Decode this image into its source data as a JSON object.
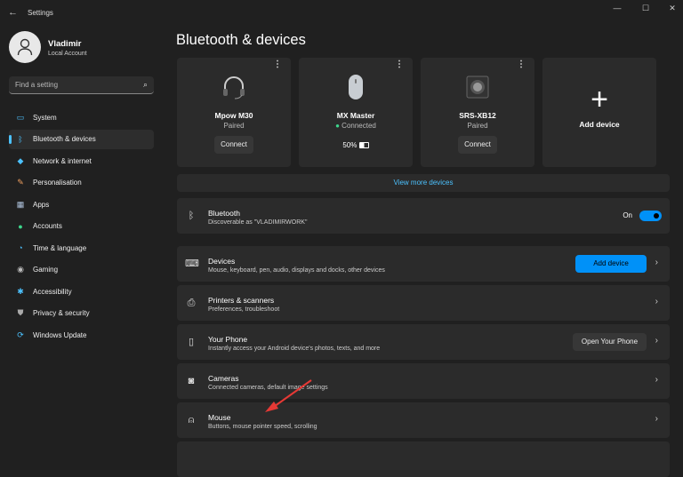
{
  "window": {
    "title": "Settings",
    "back": "←",
    "minimize": "—",
    "maximize": "☐",
    "close": "✕"
  },
  "user": {
    "name": "Vladimir",
    "account": "Local Account"
  },
  "search": {
    "placeholder": "Find a setting"
  },
  "sidebar": {
    "items": [
      {
        "label": "System",
        "icon": "system-icon",
        "color": "#4cc2ff"
      },
      {
        "label": "Bluetooth & devices",
        "icon": "bluetooth-icon",
        "color": "#4cc2ff",
        "selected": true
      },
      {
        "label": "Network & internet",
        "icon": "wifi-icon",
        "color": "#4cc2ff"
      },
      {
        "label": "Personalisation",
        "icon": "brush-icon",
        "color": "#f0a060"
      },
      {
        "label": "Apps",
        "icon": "apps-icon",
        "color": "#b0c4de"
      },
      {
        "label": "Accounts",
        "icon": "accounts-icon",
        "color": "#3dd68c"
      },
      {
        "label": "Time & language",
        "icon": "globe-icon",
        "color": "#4cc2ff"
      },
      {
        "label": "Gaming",
        "icon": "gamepad-icon",
        "color": "#bbb"
      },
      {
        "label": "Accessibility",
        "icon": "accessibility-icon",
        "color": "#4cc2ff"
      },
      {
        "label": "Privacy & security",
        "icon": "shield-icon",
        "color": "#aaa"
      },
      {
        "label": "Windows Update",
        "icon": "update-icon",
        "color": "#4cc2ff"
      }
    ]
  },
  "main": {
    "title": "Bluetooth & devices",
    "devices": [
      {
        "name": "Mpow M30",
        "status": "Paired",
        "button": "Connect"
      },
      {
        "name": "MX Master",
        "status": "Connected",
        "battery": "50%"
      },
      {
        "name": "SRS-XB12",
        "status": "Paired",
        "button": "Connect"
      }
    ],
    "add_device_card": "Add device",
    "view_more": "View more devices",
    "bluetooth": {
      "title": "Bluetooth",
      "subtitle": "Discoverable as \"VLADIMIRWORK\"",
      "state": "On"
    },
    "rows": [
      {
        "title": "Devices",
        "subtitle": "Mouse, keyboard, pen, audio, displays and docks, other devices",
        "button": "Add device"
      },
      {
        "title": "Printers & scanners",
        "subtitle": "Preferences, troubleshoot"
      },
      {
        "title": "Your Phone",
        "subtitle": "Instantly access your Android device's photos, texts, and more",
        "button": "Open Your Phone"
      },
      {
        "title": "Cameras",
        "subtitle": "Connected cameras, default image settings"
      },
      {
        "title": "Mouse",
        "subtitle": "Buttons, mouse pointer speed, scrolling"
      }
    ]
  },
  "colors": {
    "accent": "#0091f8",
    "link": "#4cc2ff",
    "annotation_arrow": "#e53935",
    "connected_dot": "#3dd68c"
  }
}
